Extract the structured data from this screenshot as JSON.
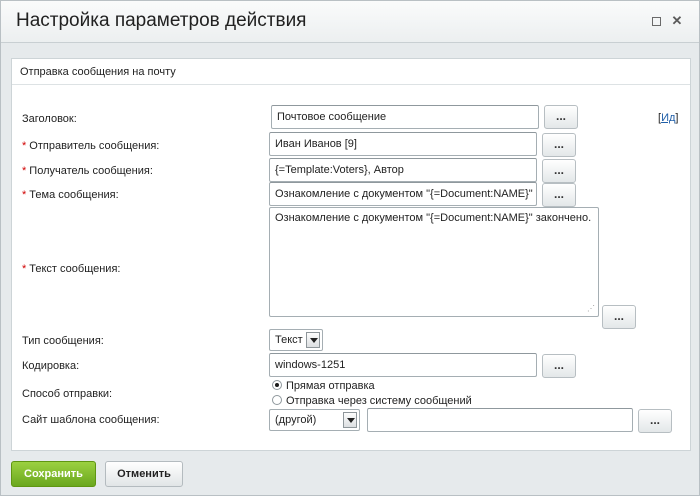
{
  "dialog": {
    "title": "Настройка параметров действия"
  },
  "section": {
    "title": "Отправка сообщения на почту"
  },
  "fields": {
    "subject_header": {
      "label": "Заголовок:",
      "value": "Почтовое сообщение"
    },
    "sender": {
      "label": "Отправитель сообщения:",
      "value": "Иван Иванов [9]"
    },
    "recipient": {
      "label": "Получатель сообщения:",
      "value": "{=Template:Voters}, Автор"
    },
    "topic": {
      "label": "Тема сообщения:",
      "value": "Ознакомление с документом \"{=Document:NAME}\""
    },
    "body": {
      "label": "Текст сообщения:",
      "value": "Ознакомление с документом \"{=Document:NAME}\" закончено."
    },
    "message_type": {
      "label": "Тип сообщения:",
      "value": "Текст"
    },
    "encoding": {
      "label": "Кодировка:",
      "value": "windows-1251"
    },
    "send_method": {
      "label": "Способ отправки:",
      "options": [
        "Прямая отправка",
        "Отправка через систему сообщений"
      ],
      "selected": "Прямая отправка"
    },
    "template_site": {
      "label": "Сайт шаблона сообщения:",
      "select_value": "(другой)",
      "value": ""
    }
  },
  "required_mark": "*",
  "dots_label": "...",
  "id_link": {
    "open": "[",
    "text": "Ид",
    "close": "]"
  },
  "buttons": {
    "save": "Сохранить",
    "cancel": "Отменить"
  },
  "icons": {
    "maximize": "maximize-icon",
    "close": "close-icon",
    "resize": "resize-grip-icon"
  },
  "colors": {
    "save_button": "#7ab62b",
    "required": "#d00000",
    "link": "#1f5ea8"
  }
}
